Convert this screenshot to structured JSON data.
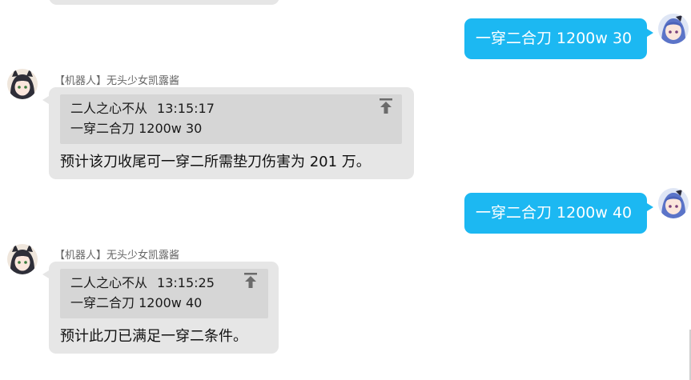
{
  "messages": [
    {
      "type": "outgoing",
      "text": "一穿二合刀 1200w 30",
      "avatar": "anime-girl-blue-hair-avatar"
    },
    {
      "type": "incoming",
      "sender": "【机器人】无头少女凯露酱",
      "avatar": "anime-girl-black-hair-cat-ears-avatar",
      "quote": {
        "author": "二人之心不从",
        "time": "13:15:17",
        "text": "一穿二合刀 1200w 30",
        "icon": "jump-to-message-icon"
      },
      "text": "预计该刀收尾可一穿二所需垫刀伤害为 201 万。"
    },
    {
      "type": "outgoing",
      "text": "一穿二合刀 1200w 40",
      "avatar": "anime-girl-blue-hair-avatar"
    },
    {
      "type": "incoming",
      "sender": "【机器人】无头少女凯露酱",
      "avatar": "anime-girl-black-hair-cat-ears-avatar",
      "quote": {
        "author": "二人之心不从",
        "time": "13:15:25",
        "text": "一穿二合刀 1200w 40",
        "icon": "jump-to-message-icon"
      },
      "text": "预计此刀已满足一穿二条件。"
    }
  ],
  "colors": {
    "outgoing_bubble": "#1cb8f2",
    "incoming_bubble": "#e6e6e6",
    "quote_bg": "#d6d6d6",
    "sender_name": "#666666"
  }
}
